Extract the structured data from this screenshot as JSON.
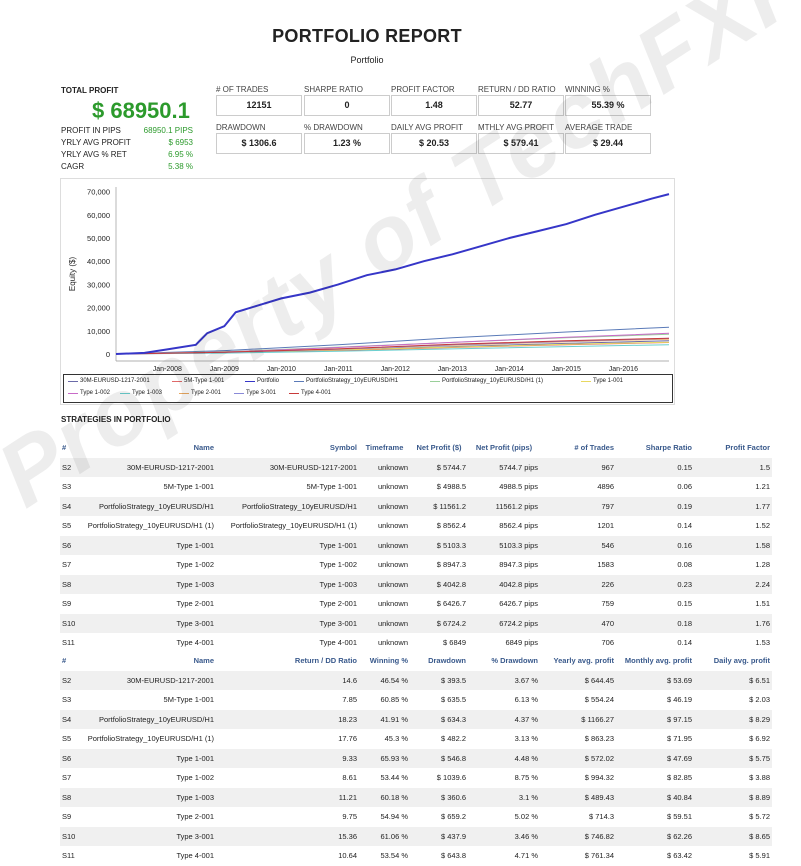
{
  "report": {
    "title": "PORTFOLIO REPORT",
    "subtitle": "Portfolio"
  },
  "summary": {
    "total_profit_label": "TOTAL PROFIT",
    "total_profit": "$ 68950.1",
    "rows": [
      {
        "label": "PROFIT IN PIPS",
        "value": "68950.1 PIPS"
      },
      {
        "label": "YRLY AVG PROFIT",
        "value": "$ 6953"
      },
      {
        "label": "YRLY AVG % RET",
        "value": "6.95 %"
      },
      {
        "label": "CAGR",
        "value": "5.38 %"
      }
    ]
  },
  "metrics": [
    {
      "label": "# OF TRADES",
      "value": "12151"
    },
    {
      "label": "SHARPE RATIO",
      "value": "0"
    },
    {
      "label": "PROFIT FACTOR",
      "value": "1.48"
    },
    {
      "label": "RETURN / DD RATIO",
      "value": "52.77"
    },
    {
      "label": "WINNING %",
      "value": "55.39 %"
    },
    {
      "label": "DRAWDOWN",
      "value": "$ 1306.6"
    },
    {
      "label": "% DRAWDOWN",
      "value": "1.23 %"
    },
    {
      "label": "DAILY AVG PROFIT",
      "value": "$ 20.53"
    },
    {
      "label": "MTHLY AVG PROFIT",
      "value": "$ 579.41"
    },
    {
      "label": "AVERAGE TRADE",
      "value": "$ 29.44"
    }
  ],
  "chart_data": {
    "type": "line",
    "ylabel": "Equity ($)",
    "ylim": [
      -3000,
      72000
    ],
    "yticks": [
      "70,000",
      "60,000",
      "50,000",
      "40,000",
      "30,000",
      "20,000",
      "10,000",
      "0"
    ],
    "ytick_values": [
      70000,
      60000,
      50000,
      40000,
      30000,
      20000,
      10000,
      0
    ],
    "xticks": [
      "Jan-2008",
      "Jan-2009",
      "Jan-2010",
      "Jan-2011",
      "Jan-2012",
      "Jan-2013",
      "Jan-2014",
      "Jan-2015",
      "Jan-2016"
    ],
    "xlim": [
      2007.1,
      2016.8
    ],
    "xtick_values": [
      2008,
      2009,
      2010,
      2011,
      2012,
      2013,
      2014,
      2015,
      2016
    ],
    "grid": false,
    "legend_position": "bottom",
    "series": [
      {
        "name": "30M-EURUSD-1217-2001",
        "color": "#6a6aa8",
        "x": [
          2007.1,
          2009,
          2011,
          2013,
          2015,
          2016.8
        ],
        "y": [
          0,
          600,
          1800,
          3200,
          4600,
          5744.7
        ]
      },
      {
        "name": "5M-Type 1-001",
        "color": "#e06a6a",
        "x": [
          2007.1,
          2009,
          2011,
          2013,
          2015,
          2016.8
        ],
        "y": [
          0,
          500,
          1500,
          2800,
          4000,
          4988.5
        ]
      },
      {
        "name": "Portfolio",
        "color": "#3636c8",
        "x": [
          2007.1,
          2007.6,
          2008.0,
          2008.5,
          2008.7,
          2009.0,
          2009.2,
          2009.6,
          2010.0,
          2010.5,
          2011.0,
          2011.5,
          2012.0,
          2012.5,
          2013.0,
          2013.5,
          2014.0,
          2014.5,
          2015.0,
          2015.5,
          2016.0,
          2016.5,
          2016.8
        ],
        "y": [
          0,
          500,
          2000,
          4000,
          9000,
          12000,
          18000,
          21000,
          24000,
          26500,
          30000,
          34000,
          36500,
          40000,
          43000,
          46500,
          50000,
          53000,
          56000,
          60000,
          63500,
          67000,
          68950.1
        ]
      },
      {
        "name": "PortfolioStrategy_10yEURUSD/H1",
        "color": "#5a7ab8",
        "x": [
          2007.1,
          2009,
          2011,
          2013,
          2015,
          2016.8
        ],
        "y": [
          0,
          1500,
          4000,
          7000,
          9500,
          11561.2
        ]
      },
      {
        "name": "PortfolioStrategy_10yEURUSD/H1 (1)",
        "color": "#9acf9a",
        "x": [
          2007.1,
          2009,
          2011,
          2013,
          2015,
          2016.8
        ],
        "y": [
          0,
          1000,
          3000,
          5000,
          7000,
          8562.4
        ]
      },
      {
        "name": "Type 1-001",
        "color": "#e8d860",
        "x": [
          2007.1,
          2009,
          2011,
          2013,
          2015,
          2016.8
        ],
        "y": [
          0,
          700,
          1800,
          3000,
          4200,
          5103.3
        ]
      },
      {
        "name": "Type 1-002",
        "color": "#c86ac8",
        "x": [
          2007.1,
          2009,
          2011,
          2013,
          2015,
          2016.8
        ],
        "y": [
          0,
          900,
          2800,
          5000,
          7200,
          8947.3
        ]
      },
      {
        "name": "Type 1-003",
        "color": "#6ad0d0",
        "x": [
          2007.1,
          2009,
          2011,
          2013,
          2015,
          2016.8
        ],
        "y": [
          0,
          400,
          1200,
          2200,
          3200,
          4042.8
        ]
      },
      {
        "name": "Type 2-001",
        "color": "#e8a860",
        "x": [
          2007.1,
          2009,
          2011,
          2013,
          2015,
          2016.8
        ],
        "y": [
          0,
          800,
          2200,
          3800,
          5300,
          6426.7
        ]
      },
      {
        "name": "Type 3-001",
        "color": "#8a8ad8",
        "x": [
          2007.1,
          2009,
          2011,
          2013,
          2015,
          2016.8
        ],
        "y": [
          0,
          700,
          2100,
          4000,
          5500,
          6724.2
        ]
      },
      {
        "name": "Type 4-001",
        "color": "#c83a3a",
        "x": [
          2007.1,
          2009,
          2011,
          2013,
          2015,
          2016.8
        ],
        "y": [
          0,
          800,
          2200,
          4200,
          5700,
          6849
        ]
      }
    ]
  },
  "strategies_title": "STRATEGIES IN PORTFOLIO",
  "table1": {
    "headers": [
      "#",
      "Name",
      "Symbol",
      "Timeframe",
      "Net Profit ($)",
      "Net Profit (pips)",
      "# of Trades",
      "Sharpe Ratio",
      "Profit Factor"
    ],
    "rows": [
      [
        "S2",
        "30M-EURUSD-1217-2001",
        "30M-EURUSD-1217-2001",
        "unknown",
        "$ 5744.7",
        "5744.7 pips",
        "967",
        "0.15",
        "1.5"
      ],
      [
        "S3",
        "5M-Type 1-001",
        "5M-Type 1-001",
        "unknown",
        "$ 4988.5",
        "4988.5 pips",
        "4896",
        "0.06",
        "1.21"
      ],
      [
        "S4",
        "PortfolioStrategy_10yEURUSD/H1",
        "PortfolioStrategy_10yEURUSD/H1",
        "unknown",
        "$ 11561.2",
        "11561.2 pips",
        "797",
        "0.19",
        "1.77"
      ],
      [
        "S5",
        "PortfolioStrategy_10yEURUSD/H1 (1)",
        "PortfolioStrategy_10yEURUSD/H1 (1)",
        "unknown",
        "$ 8562.4",
        "8562.4 pips",
        "1201",
        "0.14",
        "1.52"
      ],
      [
        "S6",
        "Type 1-001",
        "Type 1-001",
        "unknown",
        "$ 5103.3",
        "5103.3 pips",
        "546",
        "0.16",
        "1.58"
      ],
      [
        "S7",
        "Type 1-002",
        "Type 1-002",
        "unknown",
        "$ 8947.3",
        "8947.3 pips",
        "1583",
        "0.08",
        "1.28"
      ],
      [
        "S8",
        "Type 1-003",
        "Type 1-003",
        "unknown",
        "$ 4042.8",
        "4042.8 pips",
        "226",
        "0.23",
        "2.24"
      ],
      [
        "S9",
        "Type 2-001",
        "Type 2-001",
        "unknown",
        "$ 6426.7",
        "6426.7 pips",
        "759",
        "0.15",
        "1.51"
      ],
      [
        "S10",
        "Type 3-001",
        "Type 3-001",
        "unknown",
        "$ 6724.2",
        "6724.2 pips",
        "470",
        "0.18",
        "1.76"
      ],
      [
        "S11",
        "Type 4-001",
        "Type 4-001",
        "unknown",
        "$ 6849",
        "6849 pips",
        "706",
        "0.14",
        "1.53"
      ]
    ]
  },
  "table2": {
    "headers": [
      "#",
      "Name",
      "Return / DD Ratio",
      "Winning %",
      "Drawdown",
      "% Drawdown",
      "Yearly avg. profit",
      "Monthly avg. profit",
      "Daily avg. profit"
    ],
    "rows": [
      [
        "S2",
        "30M-EURUSD-1217-2001",
        "14.6",
        "46.54 %",
        "$ 393.5",
        "3.67 %",
        "$ 644.45",
        "$ 53.69",
        "$ 6.51"
      ],
      [
        "S3",
        "5M-Type 1-001",
        "7.85",
        "60.85 %",
        "$ 635.5",
        "6.13 %",
        "$ 554.24",
        "$ 46.19",
        "$ 2.03"
      ],
      [
        "S4",
        "PortfolioStrategy_10yEURUSD/H1",
        "18.23",
        "41.91 %",
        "$ 634.3",
        "4.37 %",
        "$ 1166.27",
        "$ 97.15",
        "$ 8.29"
      ],
      [
        "S5",
        "PortfolioStrategy_10yEURUSD/H1 (1)",
        "17.76",
        "45.3 %",
        "$ 482.2",
        "3.13 %",
        "$ 863.23",
        "$ 71.95",
        "$ 6.92"
      ],
      [
        "S6",
        "Type 1-001",
        "9.33",
        "65.93 %",
        "$ 546.8",
        "4.48 %",
        "$ 572.02",
        "$ 47.69",
        "$ 5.75"
      ],
      [
        "S7",
        "Type 1-002",
        "8.61",
        "53.44 %",
        "$ 1039.6",
        "8.75 %",
        "$ 994.32",
        "$ 82.85",
        "$ 3.88"
      ],
      [
        "S8",
        "Type 1-003",
        "11.21",
        "60.18 %",
        "$ 360.6",
        "3.1 %",
        "$ 489.43",
        "$ 40.84",
        "$ 8.89"
      ],
      [
        "S9",
        "Type 2-001",
        "9.75",
        "54.94 %",
        "$ 659.2",
        "5.02 %",
        "$ 714.3",
        "$ 59.51",
        "$ 5.72"
      ],
      [
        "S10",
        "Type 3-001",
        "15.36",
        "61.06 %",
        "$ 437.9",
        "3.46 %",
        "$ 746.82",
        "$ 62.26",
        "$ 8.65"
      ],
      [
        "S11",
        "Type 4-001",
        "10.64",
        "53.54 %",
        "$ 643.8",
        "4.71 %",
        "$ 761.34",
        "$ 63.42",
        "$ 5.91"
      ]
    ]
  },
  "watermark": "Property of TechFXPRO.com"
}
